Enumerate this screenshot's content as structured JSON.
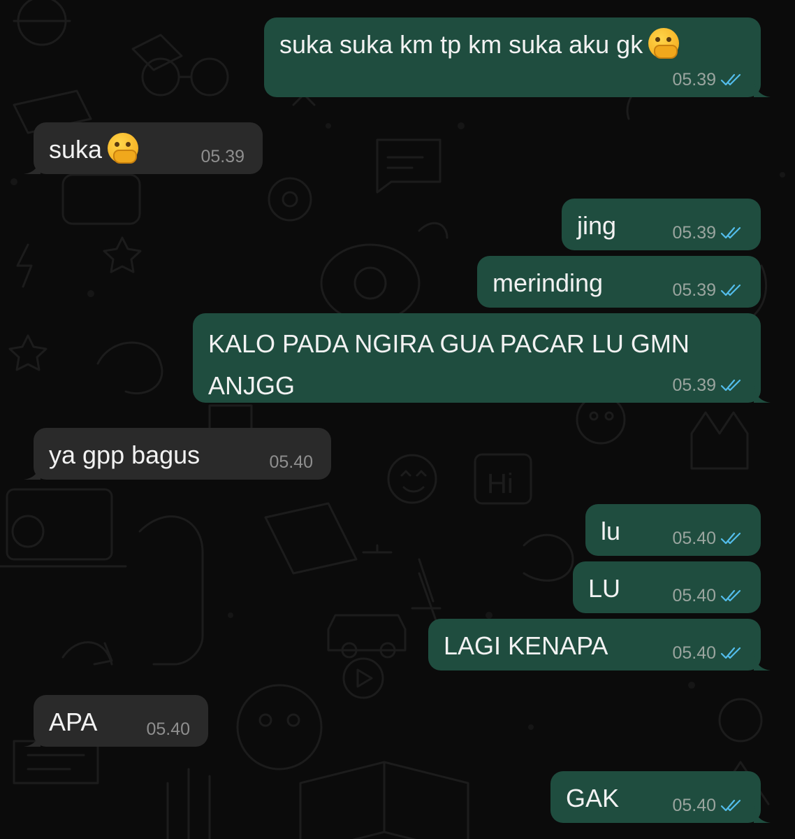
{
  "colors": {
    "background": "#0b0b0b",
    "outgoing_bubble": "#1f4d3f",
    "incoming_bubble": "#2a2a2a",
    "read_ticks": "#53bdeb"
  },
  "messages": [
    {
      "direction": "outgoing",
      "text": "suka suka km tp km suka aku gk",
      "emoji": "face-with-hand-over-mouth",
      "time": "05.39",
      "status": "read"
    },
    {
      "direction": "incoming",
      "text": "suka",
      "emoji": "face-with-hand-over-mouth",
      "time": "05.39"
    },
    {
      "direction": "outgoing",
      "text": "jing",
      "time": "05.39",
      "status": "read"
    },
    {
      "direction": "outgoing",
      "text": "merinding",
      "time": "05.39",
      "status": "read"
    },
    {
      "direction": "outgoing",
      "text": "KALO PADA NGIRA GUA PACAR LU GMN ANJGG",
      "time": "05.39",
      "status": "read"
    },
    {
      "direction": "incoming",
      "text": "ya gpp bagus",
      "time": "05.40"
    },
    {
      "direction": "outgoing",
      "text": "lu",
      "time": "05.40",
      "status": "read"
    },
    {
      "direction": "outgoing",
      "text": "LU",
      "time": "05.40",
      "status": "read"
    },
    {
      "direction": "outgoing",
      "text": "LAGI KENAPA",
      "time": "05.40",
      "status": "read"
    },
    {
      "direction": "incoming",
      "text": "APA",
      "time": "05.40"
    },
    {
      "direction": "outgoing",
      "text": "GAK",
      "time": "05.40",
      "status": "read"
    }
  ]
}
